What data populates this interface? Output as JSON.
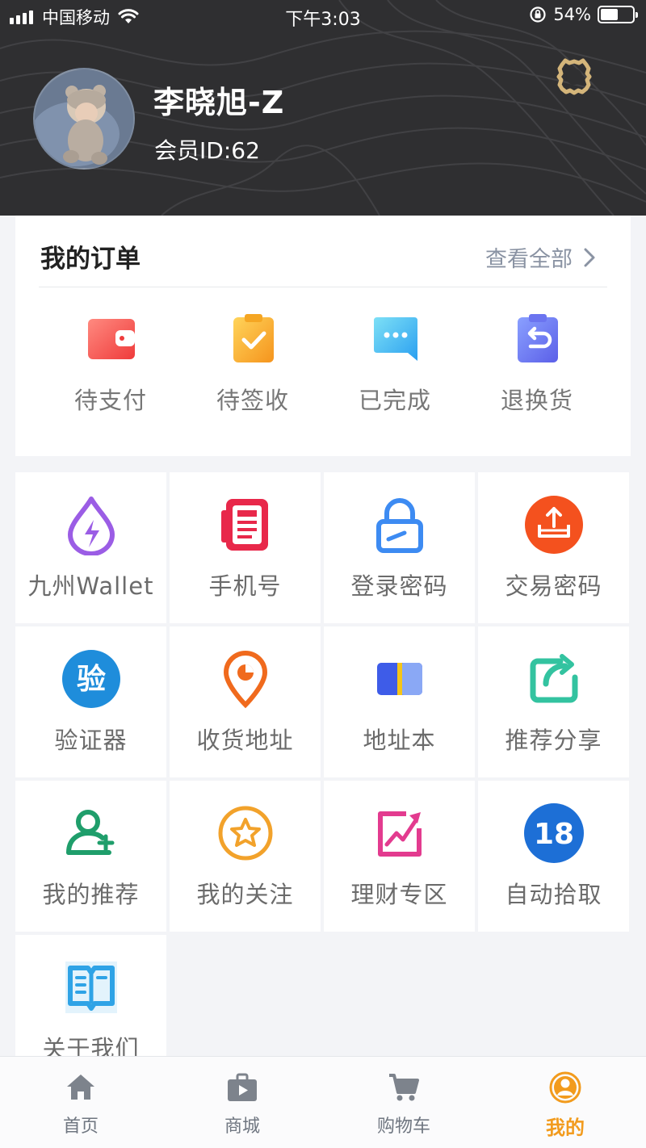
{
  "status_bar": {
    "carrier": "中国移动",
    "time": "下午3:03",
    "battery": "54%",
    "battery_level": 0.54
  },
  "profile": {
    "name": "李晓旭-Z",
    "member_id": "会员ID:62",
    "avatar_icon": "avatar-photo",
    "settings_icon": "gear-icon"
  },
  "orders": {
    "title": "我的订单",
    "view_all": "查看全部",
    "items": [
      {
        "label": "待支付",
        "icon": "wallet-icon",
        "color": "#f25858"
      },
      {
        "label": "待签收",
        "icon": "clipboard-check-icon",
        "color": "#f6a623"
      },
      {
        "label": "已完成",
        "icon": "chat-dots-icon",
        "color": "#3ab5ef"
      },
      {
        "label": "退换货",
        "icon": "return-icon",
        "color": "#5d7cf0"
      }
    ]
  },
  "menu": [
    {
      "label": "九州Wallet",
      "icon": "drop-lightning-icon",
      "color": "#9b5de5"
    },
    {
      "label": "手机号",
      "icon": "phone-book-icon",
      "color": "#e8284a"
    },
    {
      "label": "登录密码",
      "icon": "lock-icon",
      "color": "#3d8bf2"
    },
    {
      "label": "交易密码",
      "icon": "upload-box-icon",
      "color": "#f4511e"
    },
    {
      "label": "验证器",
      "icon": "verify-icon",
      "color": "#1f8ddb",
      "glyph": "验"
    },
    {
      "label": "收货地址",
      "icon": "location-pin-icon",
      "color": "#f06a1d"
    },
    {
      "label": "地址本",
      "icon": "address-book-icon",
      "color": "#3e5ce8"
    },
    {
      "label": "推荐分享",
      "icon": "share-icon",
      "color": "#33c3a0"
    },
    {
      "label": "我的推荐",
      "icon": "add-user-icon",
      "color": "#1f9e6b"
    },
    {
      "label": "我的关注",
      "icon": "star-circle-icon",
      "color": "#f2a22b"
    },
    {
      "label": "理财专区",
      "icon": "trend-chart-icon",
      "color": "#e33b8f"
    },
    {
      "label": "自动拾取",
      "icon": "badge-18-icon",
      "color": "#1d6fd6",
      "glyph": "18"
    },
    {
      "label": "关于我们",
      "icon": "book-icon",
      "color": "#2fa3e6"
    }
  ],
  "tabbar": {
    "items": [
      {
        "label": "首页",
        "icon": "home-icon"
      },
      {
        "label": "商城",
        "icon": "shop-bag-icon"
      },
      {
        "label": "购物车",
        "icon": "cart-icon"
      },
      {
        "label": "我的",
        "icon": "user-circle-icon"
      }
    ],
    "active_color": "#f29b1d",
    "inactive_color": "#6f7680"
  }
}
